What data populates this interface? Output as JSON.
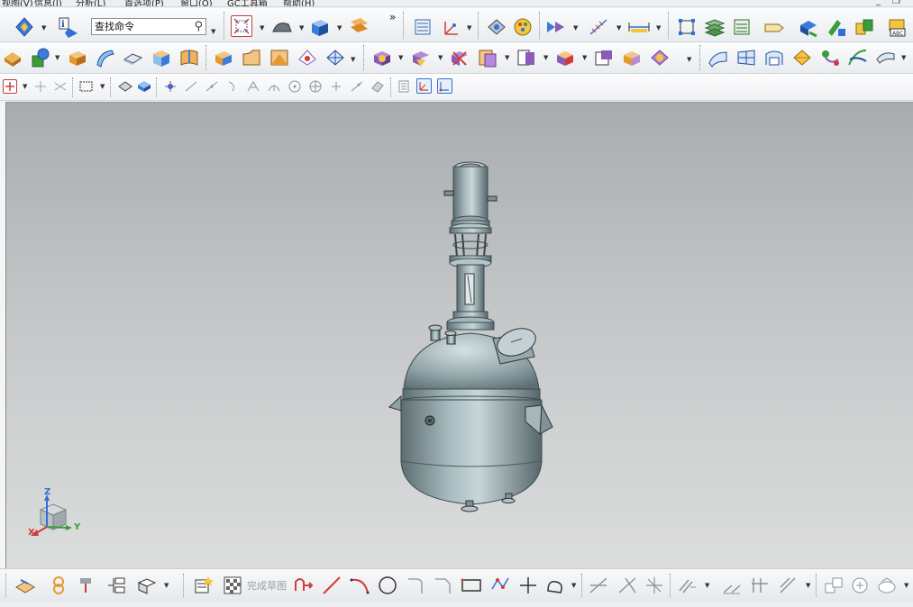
{
  "menubar": {
    "items": [
      "视图(V)",
      "信息(I)",
      "分析(L)",
      "首选项(P)",
      "窗口(O)",
      "GC工具箱",
      "帮助(H)"
    ]
  },
  "toolbar": {
    "search_placeholder": "查找命令",
    "overflow_symbol": "»"
  },
  "bottom_toolbar": {
    "finish_sketch_label": "完成草图"
  },
  "triad": {
    "x_label": "X",
    "y_label": "Y",
    "z_label": "Z"
  },
  "viewport": {
    "model": "reactor-vessel",
    "background_top": "#a9acae",
    "background_bottom": "#dcdddd",
    "model_color": "#8fa2a6"
  },
  "colors": {
    "accent_blue": "#2f6fd6",
    "icon_orange": "#e69a2e",
    "icon_green": "#3a9d3a",
    "icon_purple": "#8a5bb8",
    "icon_red": "#d03c3c"
  }
}
